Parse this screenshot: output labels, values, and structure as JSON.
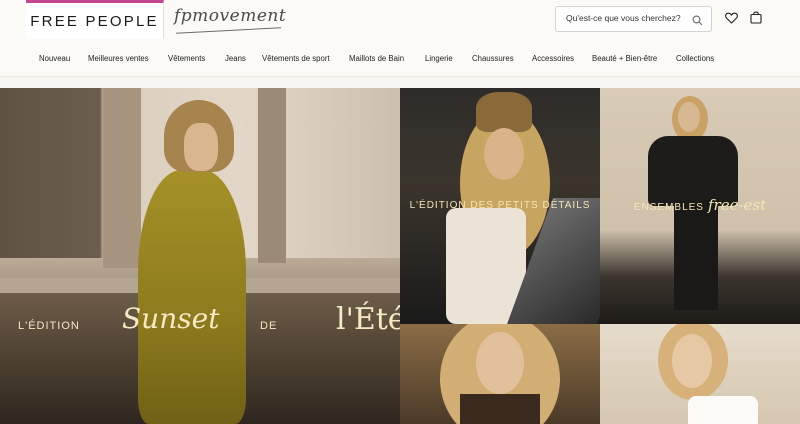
{
  "header": {
    "brand": "FREE PEOPLE",
    "sub_brand": "fpmovement",
    "search_placeholder": "Qu'est-ce que vous cherchez?"
  },
  "nav": {
    "items": [
      "Nouveau",
      "Meilleures ventes",
      "Vêtements",
      "Jeans",
      "Vêtements de sport",
      "Maillots de Bain",
      "Lingerie",
      "Chaussures",
      "Accessoires",
      "Beauté + Bien-être",
      "Collections"
    ]
  },
  "hero": {
    "caption_1": "L'ÉDITION",
    "caption_2": "Sunset",
    "caption_3": "DE",
    "caption_4": "l'Été"
  },
  "tiles": {
    "t1_caption": "L'ÉDITION DES PETITS DÉTAILS",
    "t2_caption_a": "ENSEMBLES",
    "t2_caption_b": "free-est"
  },
  "colors": {
    "brand_accent": "#c4458d",
    "caption_gold": "#f4e7b4"
  }
}
